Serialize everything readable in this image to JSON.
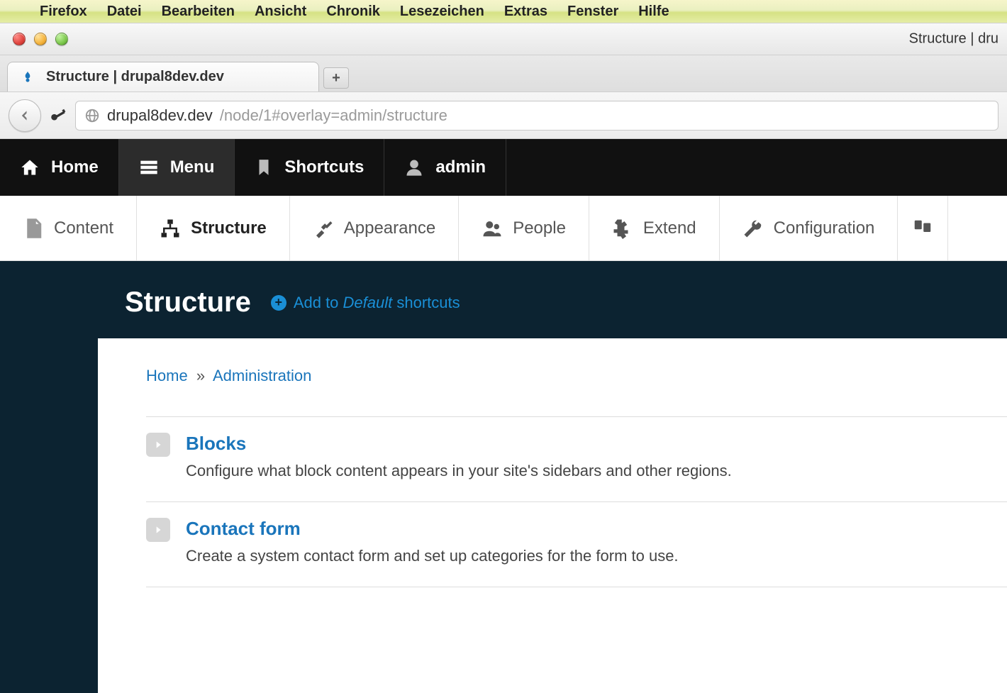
{
  "mac_menubar": {
    "app": "Firefox",
    "items": [
      "Datei",
      "Bearbeiten",
      "Ansicht",
      "Chronik",
      "Lesezeichen",
      "Extras",
      "Fenster",
      "Hilfe"
    ]
  },
  "window": {
    "title_right": "Structure | dru"
  },
  "tab": {
    "title": "Structure | drupal8dev.dev"
  },
  "url": {
    "domain": "drupal8dev.dev",
    "path": "/node/1#overlay=admin/structure"
  },
  "toolbar": {
    "home": "Home",
    "menu": "Menu",
    "shortcuts": "Shortcuts",
    "user": "admin"
  },
  "admin_tabs": {
    "content": "Content",
    "structure": "Structure",
    "appearance": "Appearance",
    "people": "People",
    "extend": "Extend",
    "configuration": "Configuration"
  },
  "page": {
    "title": "Structure",
    "shortcut_prefix": "Add to ",
    "shortcut_italic": "Default",
    "shortcut_suffix": " shortcuts"
  },
  "breadcrumb": {
    "home": "Home",
    "sep": "»",
    "admin": "Administration"
  },
  "items": [
    {
      "title": "Blocks",
      "desc": "Configure what block content appears in your site's sidebars and other regions."
    },
    {
      "title": "Contact form",
      "desc": "Create a system contact form and set up categories for the form to use."
    }
  ]
}
